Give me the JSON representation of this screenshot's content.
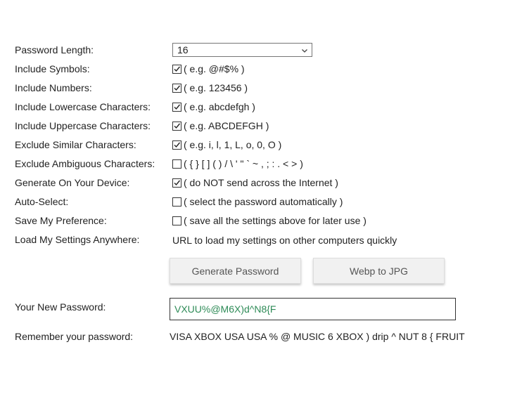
{
  "form": {
    "length": {
      "label": "Password Length:",
      "selected": "16"
    },
    "options": [
      {
        "label": "Include Symbols:",
        "checked": true,
        "hint": "( e.g. @#$% )"
      },
      {
        "label": "Include Numbers:",
        "checked": true,
        "hint": "( e.g. 123456 )"
      },
      {
        "label": "Include Lowercase Characters:",
        "checked": true,
        "hint": "( e.g. abcdefgh )"
      },
      {
        "label": "Include Uppercase Characters:",
        "checked": true,
        "hint": "( e.g. ABCDEFGH )"
      },
      {
        "label": "Exclude Similar Characters:",
        "checked": true,
        "hint": "( e.g. i, l, 1, L, o, 0, O )"
      },
      {
        "label": "Exclude Ambiguous Characters:",
        "checked": false,
        "hint": "( { } [ ] ( ) / \\ ' \" ` ~ , ; : . < > )"
      },
      {
        "label": "Generate On Your Device:",
        "checked": true,
        "hint": "( do NOT send across the Internet )"
      },
      {
        "label": "Auto-Select:",
        "checked": false,
        "hint": "( select the password automatically )"
      },
      {
        "label": "Save My Preference:",
        "checked": false,
        "hint": "( save all the settings above for later use )"
      }
    ],
    "load_settings": {
      "label": "Load My Settings Anywhere:",
      "link_text": "URL to load my settings on other computers quickly"
    }
  },
  "buttons": {
    "generate": "Generate Password",
    "convert": "Webp to JPG"
  },
  "result": {
    "label": "Your New Password:",
    "password": "VXUU%@M6X)d^N8{F",
    "remember_label": "Remember your password:",
    "phrase": "VISA XBOX USA USA % @ MUSIC 6 XBOX ) drip ^ NUT 8 { FRUIT"
  },
  "colors": {
    "password_text": "#2e8b57",
    "checkbox_border": "#333333"
  }
}
